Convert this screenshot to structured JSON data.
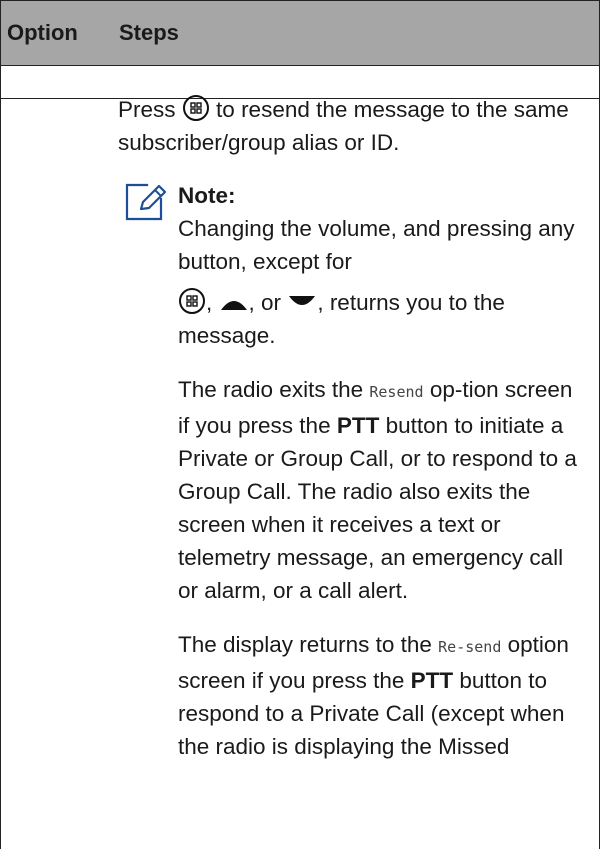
{
  "table": {
    "col1": "Option",
    "col2": "Steps"
  },
  "steps": {
    "p1_a": "Press",
    "p1_b": "to resend the message to the same subscriber/group alias or ID.",
    "note_title": "Note:",
    "note_p1_a": "Changing the volume, and pressing any button, except for",
    "note_p1_b": ",",
    "note_p1_c": ", or",
    "note_p1_d": ", returns you to the message.",
    "note_p2_a": "The radio exits the",
    "note_p2_code": "Resend",
    "note_p2_b": "op-tion screen if you press the",
    "note_p2_ptt": "PTT",
    "note_p2_c": "button to initiate a Private or Group Call, or to respond to a Group Call. The radio also exits the screen when it receives a text or telemetry message, an emergency call or alarm, or a call alert.",
    "note_p3_a": "The display returns to the",
    "note_p3_code": "Re-send",
    "note_p3_b": "option screen if you press the",
    "note_p3_ptt": "PTT",
    "note_p3_c": "button to respond to a Private Call (except when the radio is displaying the Missed"
  },
  "icons": [
    "menu-ok-button-icon",
    "note-pencil-icon",
    "up-arrow-icon",
    "down-arrow-icon"
  ]
}
